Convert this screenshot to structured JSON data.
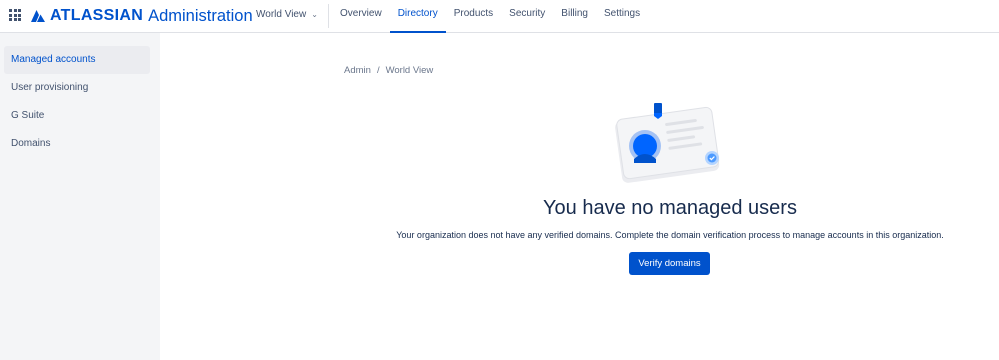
{
  "header": {
    "brand": "ATLASSIAN",
    "product": "Administration",
    "org_name": "World View",
    "nav": [
      {
        "label": "Overview"
      },
      {
        "label": "Directory",
        "active": true
      },
      {
        "label": "Products"
      },
      {
        "label": "Security"
      },
      {
        "label": "Billing"
      },
      {
        "label": "Settings"
      }
    ]
  },
  "sidebar": {
    "items": [
      {
        "label": "Managed accounts",
        "active": true
      },
      {
        "label": "User provisioning"
      },
      {
        "label": "G Suite"
      },
      {
        "label": "Domains"
      }
    ]
  },
  "breadcrumb": {
    "root": "Admin",
    "separator": "/",
    "current": "World View"
  },
  "empty_state": {
    "title": "You have no managed users",
    "description": "Your organization does not have any verified domains. Complete the domain verification process to manage accounts in this organization.",
    "button_label": "Verify domains"
  },
  "colors": {
    "accent": "#0052cc",
    "sidebar_bg": "#f4f5f7",
    "text": "#172b4d"
  }
}
